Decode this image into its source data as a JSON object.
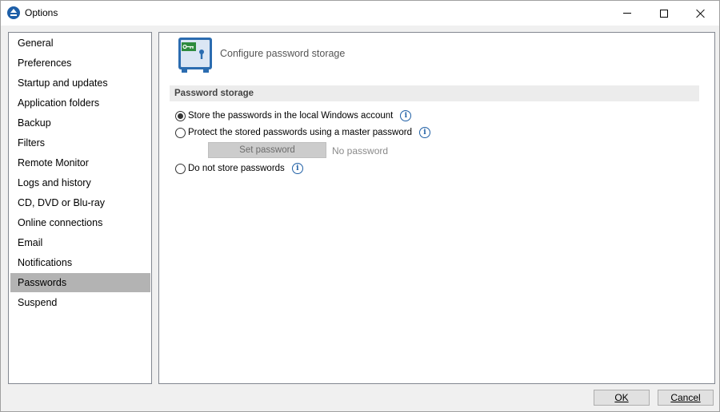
{
  "window": {
    "title": "Options"
  },
  "nav": {
    "items": [
      {
        "label": "General"
      },
      {
        "label": "Preferences"
      },
      {
        "label": "Startup and updates"
      },
      {
        "label": "Application folders"
      },
      {
        "label": "Backup"
      },
      {
        "label": "Filters"
      },
      {
        "label": "Remote Monitor"
      },
      {
        "label": "Logs and history"
      },
      {
        "label": "CD, DVD or Blu-ray"
      },
      {
        "label": "Online connections"
      },
      {
        "label": "Email"
      },
      {
        "label": "Notifications"
      },
      {
        "label": "Passwords"
      },
      {
        "label": "Suspend"
      }
    ],
    "selected": "Passwords"
  },
  "panel": {
    "header": "Configure password storage",
    "section_title": "Password storage",
    "options": [
      {
        "label": "Store the passwords in the local Windows account",
        "checked": true
      },
      {
        "label": "Protect the stored passwords using a master password",
        "checked": false
      },
      {
        "label": "Do not store passwords",
        "checked": false
      }
    ],
    "set_password_label": "Set password",
    "password_status": "No password"
  },
  "buttons": {
    "ok_label": "OK",
    "cancel_label": "Cancel"
  },
  "colors": {
    "selection": "#b3b3b3",
    "info_icon": "#1f5fa5",
    "safe_body": "#2b6cb0"
  }
}
